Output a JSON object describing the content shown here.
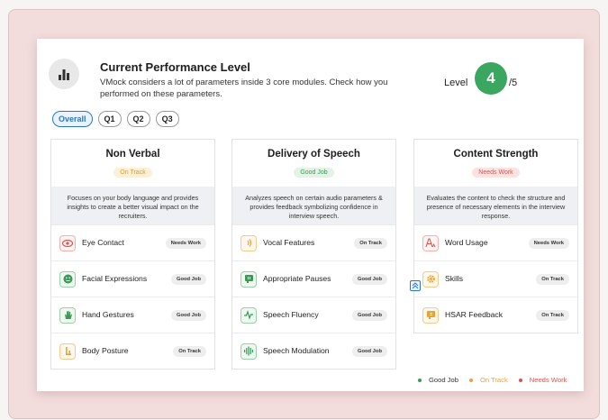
{
  "header": {
    "title": "Current Performance Level",
    "description": "VMock considers a lot of parameters inside 3 core modules. Check how you performed on these parameters.",
    "level_label": "Level",
    "level_value": "4",
    "level_max": "/5"
  },
  "tabs": [
    {
      "label": "Overall",
      "active": true
    },
    {
      "label": "Q1",
      "active": false
    },
    {
      "label": "Q2",
      "active": false
    },
    {
      "label": "Q3",
      "active": false
    }
  ],
  "modules": [
    {
      "title": "Non Verbal",
      "status": "On Track",
      "description": "Focuses on your body language and provides insights to create a better visual impact on the recruiters.",
      "params": [
        {
          "label": "Eye Contact",
          "badge": "Needs Work",
          "icon": "eye-icon"
        },
        {
          "label": "Facial Expressions",
          "badge": "Good Job",
          "icon": "face-icon"
        },
        {
          "label": "Hand Gestures",
          "badge": "Good Job",
          "icon": "hand-icon"
        },
        {
          "label": "Body Posture",
          "badge": "On Track",
          "icon": "posture-icon"
        }
      ]
    },
    {
      "title": "Delivery of Speech",
      "status": "Good Job",
      "description": "Analyzes speech on certain audio parameters & provides feedback symbolizing confidence in interview speech.",
      "params": [
        {
          "label": "Vocal Features",
          "badge": "On Track",
          "icon": "sound-wave-icon"
        },
        {
          "label": "Appropriate Pauses",
          "badge": "Good Job",
          "icon": "pause-icon"
        },
        {
          "label": "Speech Fluency",
          "badge": "Good Job",
          "icon": "pulse-icon"
        },
        {
          "label": "Speech Modulation",
          "badge": "Good Job",
          "icon": "waveform-icon"
        }
      ]
    },
    {
      "title": "Content Strength",
      "status": "Needs Work",
      "description": "Evaluates the content to check the structure and presence of necessary elements in the interview response.",
      "params": [
        {
          "label": "Word Usage",
          "badge": "Needs Work",
          "icon": "text-icon"
        },
        {
          "label": "Skills",
          "badge": "On Track",
          "icon": "gear-icon"
        },
        {
          "label": "HSAR Feedback",
          "badge": "On Track",
          "icon": "feedback-icon"
        }
      ]
    }
  ],
  "legend": [
    {
      "label": "Good Job",
      "color": "#3a9a55"
    },
    {
      "label": "On Track",
      "color": "#e9a23b"
    },
    {
      "label": "Needs Work",
      "color": "#d9534f"
    }
  ],
  "colors": {
    "accent_blue": "#2b78c2",
    "good": "#3a9a55",
    "on_track": "#e9a23b",
    "needs_work": "#d9534f",
    "background_pink": "#f3dcdc"
  }
}
